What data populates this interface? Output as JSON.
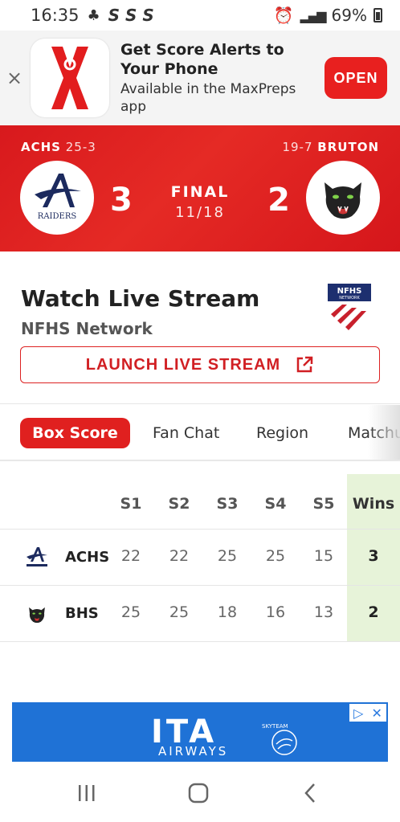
{
  "status_bar": {
    "time": "16:35",
    "indicators": "S S S",
    "battery": "69%",
    "icons": [
      "alarm-icon",
      "signal-icon",
      "battery-icon"
    ]
  },
  "app_banner": {
    "title": "Get Score Alerts to Your Phone",
    "subtitle": "Available in the MaxPreps app",
    "open_label": "OPEN",
    "close_label": "×"
  },
  "scoreboard": {
    "home": {
      "abbr": "ACHS",
      "record": "25-3",
      "score": "3",
      "logo_text": "RAIDERS"
    },
    "away": {
      "abbr": "BRUTON",
      "record": "19-7",
      "score": "2"
    },
    "status": "FINAL",
    "date": "11/18"
  },
  "stream": {
    "title": "Watch Live Stream",
    "provider": "NFHS Network",
    "button_label": "LAUNCH LIVE STREAM",
    "logo_text": "NFHS",
    "logo_sub": "NETWORK"
  },
  "tabs": [
    {
      "label": "Box Score",
      "active": true
    },
    {
      "label": "Fan Chat",
      "active": false
    },
    {
      "label": "Region",
      "active": false
    },
    {
      "label": "Matchu",
      "active": false
    }
  ],
  "box_score": {
    "headers": [
      "S1",
      "S2",
      "S3",
      "S4",
      "S5",
      "Wins"
    ],
    "rows": [
      {
        "team": "ACHS",
        "sets": [
          "22",
          "22",
          "25",
          "25",
          "15"
        ],
        "wins": "3"
      },
      {
        "team": "BHS",
        "sets": [
          "25",
          "25",
          "18",
          "16",
          "13"
        ],
        "wins": "2"
      }
    ]
  },
  "ad": {
    "brand": "ITA",
    "sub": "AIRWAYS",
    "skyteam": "SKYTEAM"
  },
  "colors": {
    "brand_red": "#e0201f",
    "wins_bg": "#e7f3d9",
    "ad_blue": "#1f72d6"
  }
}
